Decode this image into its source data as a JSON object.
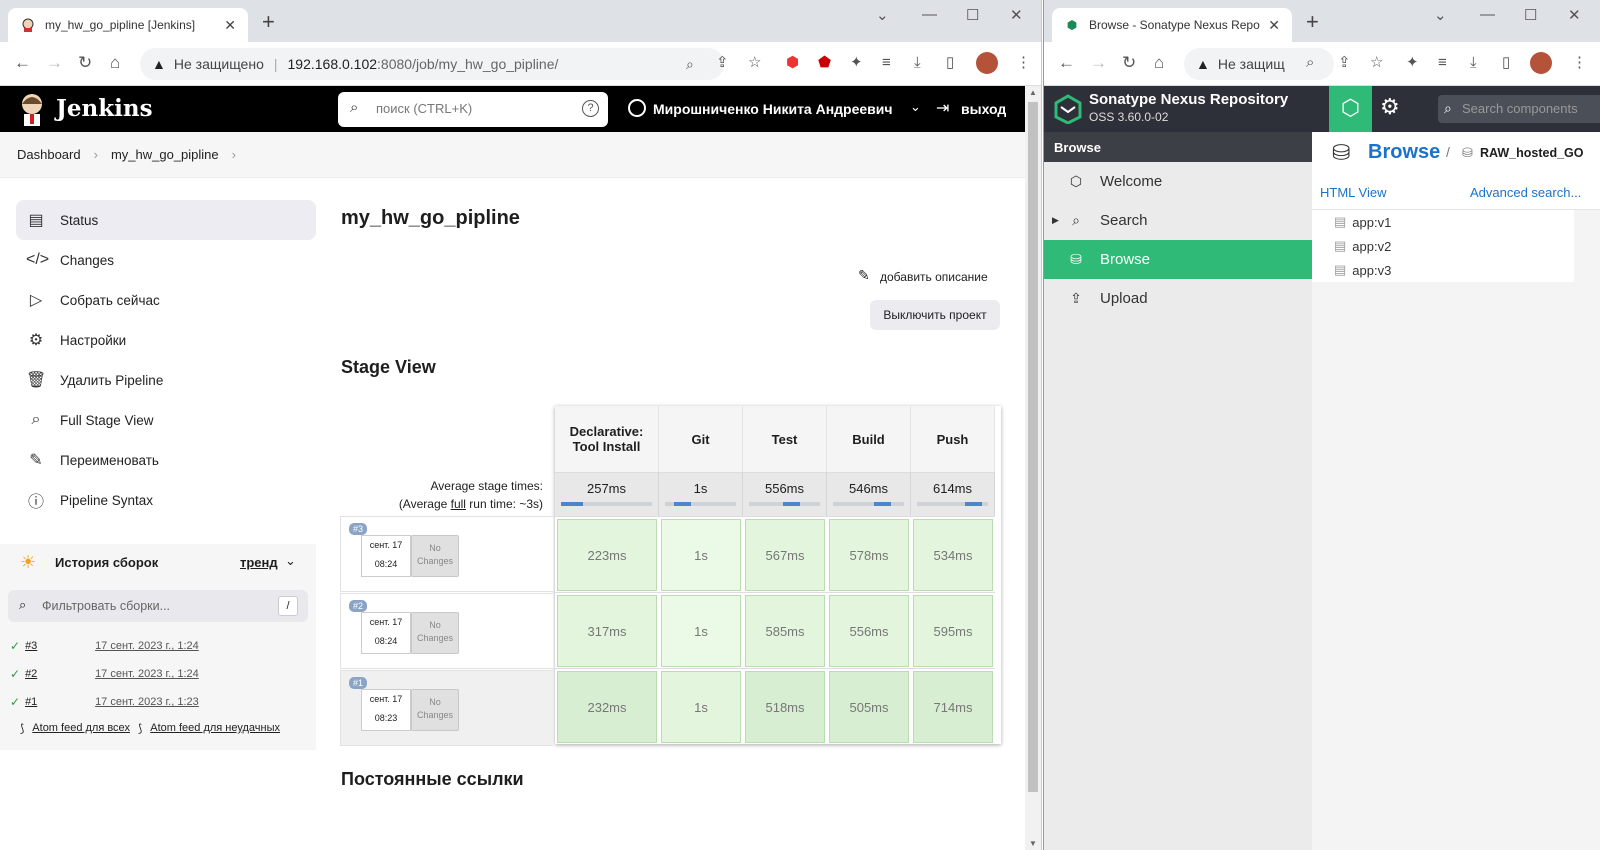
{
  "jenkins_window": {
    "tab_title": "my_hw_go_pipline [Jenkins]",
    "address_security": "Не защищено",
    "address_host": "192.168.0.102",
    "address_rest": ":8080/job/my_hw_go_pipline/",
    "header": {
      "brand": "Jenkins",
      "search_placeholder": "поиск (CTRL+K)",
      "user_name": "Мирошниченко Никита Андреевич",
      "logout_label": "выход"
    },
    "breadcrumb": [
      "Dashboard",
      "my_hw_go_pipline"
    ],
    "sidebar": [
      {
        "label": "Status",
        "icon": "status-icon"
      },
      {
        "label": "Changes",
        "icon": "code-icon"
      },
      {
        "label": "Собрать сейчас",
        "icon": "play-icon"
      },
      {
        "label": "Настройки",
        "icon": "gear-icon"
      },
      {
        "label": "Удалить Pipeline",
        "icon": "trash-icon"
      },
      {
        "label": "Full Stage View",
        "icon": "search-icon"
      },
      {
        "label": "Переименовать",
        "icon": "pencil-icon"
      },
      {
        "label": "Pipeline Syntax",
        "icon": "help-icon"
      }
    ],
    "history": {
      "title": "История сборок",
      "trend_label": "тренд",
      "filter_placeholder": "Фильтровать сборки...",
      "filter_shortcut": "/",
      "builds": [
        {
          "id": "#3",
          "date": "17 сент. 2023 г., 1:24"
        },
        {
          "id": "#2",
          "date": "17 сент. 2023 г., 1:24"
        },
        {
          "id": "#1",
          "date": "17 сент. 2023 г., 1:23"
        }
      ],
      "feed_all": "Atom feed для всех",
      "feed_failed": "Atom feed для неудачных"
    },
    "main": {
      "title": "my_hw_go_pipline",
      "add_description": "добавить описание",
      "disable_project": "Выключить проект",
      "stage_view_title": "Stage View",
      "avg_label": "Average stage times:",
      "avg_run_prefix": "(Average ",
      "avg_run_link": "full",
      "avg_run_suffix": " run time: ~3s)",
      "stages": [
        "Declarative: Tool Install",
        "Git",
        "Test",
        "Build",
        "Push"
      ],
      "avg_times": [
        "257ms",
        "1s",
        "556ms",
        "546ms",
        "614ms"
      ],
      "avg_progress": [
        0.05,
        0.25,
        0.6,
        0.7,
        0.8
      ],
      "runs": [
        {
          "badge": "#3",
          "date": "сент. 17",
          "time": "08:24",
          "changes_line1": "No",
          "changes_line2": "Changes",
          "durations": [
            "223ms",
            "1s",
            "567ms",
            "578ms",
            "534ms"
          ]
        },
        {
          "badge": "#2",
          "date": "сент. 17",
          "time": "08:24",
          "changes_line1": "No",
          "changes_line2": "Changes",
          "durations": [
            "317ms",
            "1s",
            "585ms",
            "556ms",
            "595ms"
          ]
        },
        {
          "badge": "#1",
          "date": "сент. 17",
          "time": "08:23",
          "changes_line1": "No",
          "changes_line2": "Changes",
          "durations": [
            "232ms",
            "1s",
            "518ms",
            "505ms",
            "714ms"
          ]
        }
      ],
      "permalinks_title": "Постоянные ссылки"
    }
  },
  "nexus_window": {
    "tab_title": "Browse - Sonatype Nexus Reposi",
    "address_security": "Не защищ",
    "brand_title": "Sonatype Nexus Repository",
    "brand_version": "OSS 3.60.0-02",
    "search_placeholder": "Search components",
    "section_label": "Browse",
    "nav": [
      {
        "label": "Welcome",
        "icon": "hexagon-icon"
      },
      {
        "label": "Search",
        "icon": "search-icon"
      },
      {
        "label": "Browse",
        "icon": "database-icon"
      },
      {
        "label": "Upload",
        "icon": "upload-icon"
      }
    ],
    "main": {
      "title": "Browse",
      "separator": "/",
      "repo": "RAW_hosted_GO",
      "html_view": "HTML View",
      "advanced_search": "Advanced search...",
      "tree": [
        "app:v1",
        "app:v2",
        "app:v3"
      ]
    }
  },
  "colors": {
    "jenkins_header": "#000000",
    "nexus_accent": "#30ba78",
    "link_blue": "#1a73c8",
    "stage_green": "#e2f5dc"
  }
}
